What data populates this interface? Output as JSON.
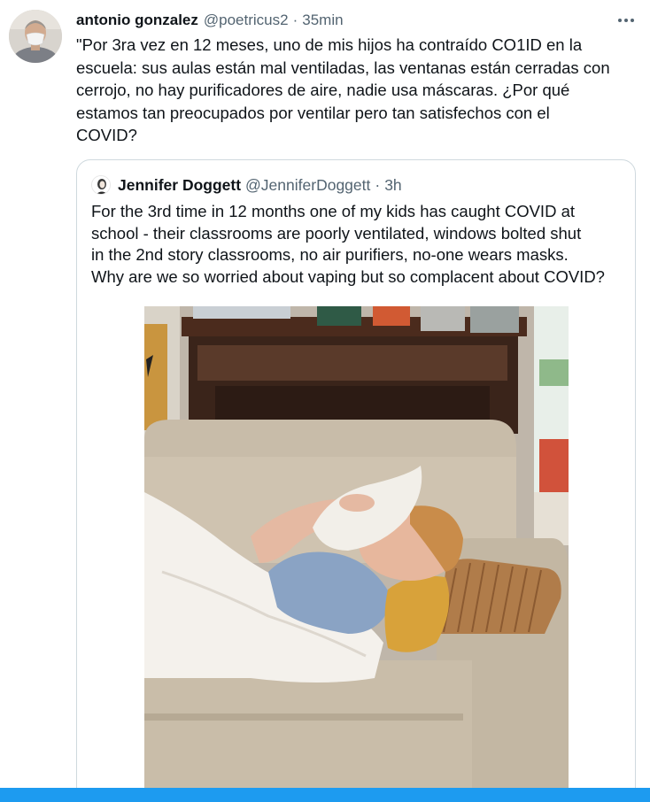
{
  "tweet": {
    "author_name": "antonio gonzalez",
    "author_handle": "@poetricus2",
    "separator": "·",
    "time": "35min",
    "text": "\"Por 3ra vez en 12 meses, uno de mis hijos ha contraído CO1ID en la\nescuela: sus aulas están mal ventiladas, las ventanas están cerradas con\ncerrojo, no hay purificadores de aire, nadie usa máscaras. ¿Por qué\nestamos tan preocupados por ventilar pero tan satisfechos con el\nCOVID?",
    "more_icon": "more-horizontal-icon"
  },
  "quoted_tweet": {
    "author_name": "Jennifer Doggett",
    "author_handle": "@JenniferDoggett",
    "separator": "·",
    "time": "3h",
    "text": "For the 3rd time in 12 months one of my kids has caught COVID at\nschool - their classrooms are poorly ventilated, windows bolted shut\nin the 2nd story classrooms, no air purifiers, no-one wears masks.\nWhy are we so worried about vaping but so complacent about COVID?"
  },
  "colors": {
    "text": "#0f1419",
    "secondary": "#536471",
    "border": "#cfd9de",
    "accent": "#1d9bf0"
  }
}
